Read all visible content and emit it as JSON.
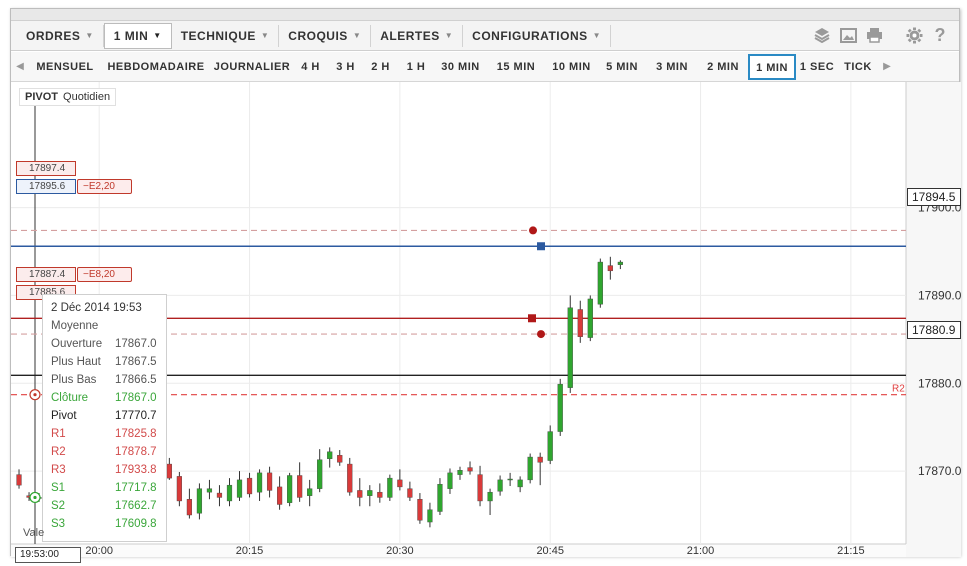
{
  "menu": [
    {
      "label": "ORDRES",
      "caret": true,
      "active": false
    },
    {
      "label": "1 MIN",
      "caret": true,
      "active": true
    },
    {
      "label": "TECHNIQUE",
      "caret": true,
      "active": false
    },
    {
      "label": "CROQUIS",
      "caret": true,
      "active": false
    },
    {
      "label": "ALERTES",
      "caret": true,
      "active": false
    },
    {
      "label": "CONFIGURATIONS",
      "caret": true,
      "active": false
    }
  ],
  "tools": [
    "layers-icon",
    "image-icon",
    "print-icon",
    "gear-icon",
    "help-icon"
  ],
  "timeframes": [
    "MENSUEL",
    "HEBDOMADAIRE",
    "JOURNALIER",
    "4 H",
    "3 H",
    "2 H",
    "1 H",
    "30 MIN",
    "15 MIN",
    "10 MIN",
    "5 MIN",
    "3 MIN",
    "2 MIN",
    "1 MIN",
    "1 SEC",
    "TICK"
  ],
  "active_timeframe": "1 MIN",
  "pivot": {
    "name": "PIVOT",
    "period": "Quotidien"
  },
  "levels": {
    "dash_top": "17897.4",
    "current": "17895.6",
    "current_order": "−E2,20",
    "mid": "17887.4",
    "mid_order": "−E8,20",
    "dash_bottom": "17885.6",
    "last_price": "17894.5",
    "cursor_price": "17880.9",
    "r2_label": "R2"
  },
  "infobox": {
    "date": "2 Déc 2014 19:53",
    "type": "Moyenne",
    "rows": [
      {
        "k": "Ouverture",
        "v": "17867.0",
        "color": "grey"
      },
      {
        "k": "Plus Haut",
        "v": "17867.5",
        "color": "grey"
      },
      {
        "k": "Plus Bas",
        "v": "17866.5",
        "color": "grey"
      },
      {
        "k": "Clôture",
        "v": "17867.0",
        "color": "green"
      },
      {
        "k": "Pivot",
        "v": "17770.7",
        "color": "dark"
      },
      {
        "k": "R1",
        "v": "17825.8",
        "color": "red"
      },
      {
        "k": "R2",
        "v": "17878.7",
        "color": "red"
      },
      {
        "k": "R3",
        "v": "17933.8",
        "color": "red"
      },
      {
        "k": "S1",
        "v": "17717.8",
        "color": "green"
      },
      {
        "k": "S2",
        "v": "17662.7",
        "color": "green"
      },
      {
        "k": "S3",
        "v": "17609.8",
        "color": "green"
      }
    ]
  },
  "cursor_time": "19:53:00",
  "val_label": "Vale",
  "chart_data": {
    "type": "candlestick",
    "y_ticks": [
      "17900.0",
      "17890.0",
      "17880.0",
      "17870.0"
    ],
    "y_ticks_values": [
      17900,
      17890,
      17880,
      17870
    ],
    "ylim": [
      17861.7,
      17914.3
    ],
    "x_ticks": [
      "20:00",
      "20:15",
      "20:30",
      "20:45",
      "21:00",
      "21:15"
    ],
    "x_ticks_minutes": [
      0,
      15,
      30,
      45,
      60,
      75
    ],
    "xlim_minutes": [
      -8.8,
      80.5
    ],
    "colors": {
      "up": "#2fa62f",
      "down": "#d93a3a",
      "level": "#c0392b",
      "current": "#2c5aa0"
    },
    "candles": [
      {
        "t": -8,
        "o": 17869.6,
        "h": 17870.2,
        "l": 17868.0,
        "c": 17868.4
      },
      {
        "t": -7,
        "o": 17867.2,
        "h": 17867.6,
        "l": 17866.6,
        "c": 17867.0
      },
      {
        "t": -6,
        "o": 17867.0,
        "h": 17867.5,
        "l": 17866.5,
        "c": 17867.0
      },
      {
        "t": -5,
        "o": 17866.5,
        "h": 17867.5,
        "l": 17866.0,
        "c": 17867.2
      },
      {
        "t": -4,
        "o": 17867.3,
        "h": 17868.0,
        "l": 17865.0,
        "c": 17865.5
      },
      {
        "t": -3,
        "o": 17865.7,
        "h": 17867.0,
        "l": 17864.0,
        "c": 17866.5
      },
      {
        "t": -2,
        "o": 17866.5,
        "h": 17867.4,
        "l": 17865.6,
        "c": 17866.0
      },
      {
        "t": -1,
        "o": 17866.1,
        "h": 17867.5,
        "l": 17865.0,
        "c": 17867.0
      },
      {
        "t": 0,
        "o": 17867.2,
        "h": 17868.5,
        "l": 17866.3,
        "c": 17866.8
      },
      {
        "t": 1,
        "o": 17866.5,
        "h": 17867.3,
        "l": 17864.8,
        "c": 17865.2
      },
      {
        "t": 2,
        "o": 17865.4,
        "h": 17867.0,
        "l": 17864.6,
        "c": 17866.8
      },
      {
        "t": 3,
        "o": 17866.8,
        "h": 17869.0,
        "l": 17866.0,
        "c": 17868.5
      },
      {
        "t": 4,
        "o": 17868.5,
        "h": 17870.5,
        "l": 17868.0,
        "c": 17870.1
      },
      {
        "t": 5,
        "o": 17869.2,
        "h": 17870.5,
        "l": 17867.5,
        "c": 17867.8
      },
      {
        "t": 6,
        "o": 17868.0,
        "h": 17869.8,
        "l": 17867.0,
        "c": 17869.3
      },
      {
        "t": 7,
        "o": 17870.8,
        "h": 17871.5,
        "l": 17869.0,
        "c": 17869.2
      },
      {
        "t": 8,
        "o": 17869.4,
        "h": 17869.9,
        "l": 17866.0,
        "c": 17866.6
      },
      {
        "t": 9,
        "o": 17866.8,
        "h": 17868.0,
        "l": 17864.6,
        "c": 17865.0
      },
      {
        "t": 10,
        "o": 17865.2,
        "h": 17868.6,
        "l": 17864.5,
        "c": 17868.0
      },
      {
        "t": 11,
        "o": 17867.6,
        "h": 17869.0,
        "l": 17866.8,
        "c": 17868.0
      },
      {
        "t": 12,
        "o": 17867.5,
        "h": 17868.4,
        "l": 17866.0,
        "c": 17867.0
      },
      {
        "t": 13,
        "o": 17866.6,
        "h": 17869.2,
        "l": 17866.0,
        "c": 17868.4
      },
      {
        "t": 14,
        "o": 17867.0,
        "h": 17870.0,
        "l": 17866.6,
        "c": 17869.0
      },
      {
        "t": 15,
        "o": 17869.2,
        "h": 17869.8,
        "l": 17867.0,
        "c": 17867.4
      },
      {
        "t": 16,
        "o": 17867.6,
        "h": 17870.2,
        "l": 17866.6,
        "c": 17869.8
      },
      {
        "t": 17,
        "o": 17869.8,
        "h": 17870.5,
        "l": 17867.0,
        "c": 17867.8
      },
      {
        "t": 18,
        "o": 17868.2,
        "h": 17869.4,
        "l": 17865.6,
        "c": 17866.2
      },
      {
        "t": 19,
        "o": 17866.4,
        "h": 17869.8,
        "l": 17866.0,
        "c": 17869.5
      },
      {
        "t": 20,
        "o": 17869.5,
        "h": 17871.0,
        "l": 17866.5,
        "c": 17867.0
      },
      {
        "t": 21,
        "o": 17867.2,
        "h": 17869.0,
        "l": 17866.0,
        "c": 17868.0
      },
      {
        "t": 22,
        "o": 17868.0,
        "h": 17872.5,
        "l": 17867.6,
        "c": 17871.3
      },
      {
        "t": 23,
        "o": 17871.4,
        "h": 17872.7,
        "l": 17870.4,
        "c": 17872.2
      },
      {
        "t": 24,
        "o": 17871.8,
        "h": 17872.4,
        "l": 17870.6,
        "c": 17871.0
      },
      {
        "t": 25,
        "o": 17870.8,
        "h": 17871.5,
        "l": 17867.2,
        "c": 17867.6
      },
      {
        "t": 26,
        "o": 17867.8,
        "h": 17869.2,
        "l": 17866.0,
        "c": 17867.0
      },
      {
        "t": 27,
        "o": 17867.2,
        "h": 17868.4,
        "l": 17866.0,
        "c": 17867.8
      },
      {
        "t": 28,
        "o": 17867.6,
        "h": 17868.6,
        "l": 17866.4,
        "c": 17867.0
      },
      {
        "t": 29,
        "o": 17867.0,
        "h": 17869.6,
        "l": 17866.6,
        "c": 17869.2
      },
      {
        "t": 30,
        "o": 17869.0,
        "h": 17870.2,
        "l": 17867.8,
        "c": 17868.2
      },
      {
        "t": 31,
        "o": 17868.0,
        "h": 17868.8,
        "l": 17866.6,
        "c": 17867.0
      },
      {
        "t": 32,
        "o": 17866.8,
        "h": 17867.5,
        "l": 17864.0,
        "c": 17864.4
      },
      {
        "t": 33,
        "o": 17864.2,
        "h": 17866.4,
        "l": 17863.6,
        "c": 17865.6
      },
      {
        "t": 34,
        "o": 17865.4,
        "h": 17869.2,
        "l": 17865.0,
        "c": 17868.5
      },
      {
        "t": 35,
        "o": 17868.0,
        "h": 17870.3,
        "l": 17867.4,
        "c": 17869.8
      },
      {
        "t": 36,
        "o": 17869.6,
        "h": 17870.5,
        "l": 17869.0,
        "c": 17870.1
      },
      {
        "t": 37,
        "o": 17870.4,
        "h": 17871.1,
        "l": 17869.6,
        "c": 17870.0
      },
      {
        "t": 38,
        "o": 17869.6,
        "h": 17870.6,
        "l": 17866.0,
        "c": 17866.6
      },
      {
        "t": 39,
        "o": 17866.6,
        "h": 17868.0,
        "l": 17865.0,
        "c": 17867.6
      },
      {
        "t": 40,
        "o": 17867.7,
        "h": 17869.5,
        "l": 17867.2,
        "c": 17869.0
      },
      {
        "t": 41,
        "o": 17869.0,
        "h": 17869.8,
        "l": 17868.3,
        "c": 17869.1
      },
      {
        "t": 42,
        "o": 17868.2,
        "h": 17869.4,
        "l": 17867.6,
        "c": 17869.0
      },
      {
        "t": 43,
        "o": 17869.0,
        "h": 17872.0,
        "l": 17868.6,
        "c": 17871.6
      },
      {
        "t": 44,
        "o": 17871.6,
        "h": 17872.1,
        "l": 17868.4,
        "c": 17871.0
      },
      {
        "t": 45,
        "o": 17871.2,
        "h": 17875.2,
        "l": 17870.8,
        "c": 17874.5
      },
      {
        "t": 46,
        "o": 17874.5,
        "h": 17880.5,
        "l": 17874.0,
        "c": 17879.9
      },
      {
        "t": 47,
        "o": 17879.5,
        "h": 17890.0,
        "l": 17878.9,
        "c": 17888.6
      },
      {
        "t": 48,
        "o": 17888.4,
        "h": 17889.4,
        "l": 17884.6,
        "c": 17885.3
      },
      {
        "t": 49,
        "o": 17885.2,
        "h": 17890.0,
        "l": 17884.8,
        "c": 17889.6
      },
      {
        "t": 50,
        "o": 17889.0,
        "h": 17894.2,
        "l": 17888.6,
        "c": 17893.8
      },
      {
        "t": 51,
        "o": 17893.4,
        "h": 17894.4,
        "l": 17891.8,
        "c": 17892.8
      },
      {
        "t": 52,
        "o": 17893.5,
        "h": 17894.0,
        "l": 17893.0,
        "c": 17893.8
      }
    ],
    "hlines": [
      {
        "value": 17897.4,
        "style": "dashed",
        "color": "#d4a0a0"
      },
      {
        "value": 17895.6,
        "style": "solid",
        "color": "#2c5aa0"
      },
      {
        "value": 17887.4,
        "style": "solid",
        "color": "#b02020"
      },
      {
        "value": 17885.6,
        "style": "dashed",
        "color": "#d4a0a0"
      },
      {
        "value": 17880.9,
        "style": "solid",
        "color": "#222222"
      },
      {
        "value": 17878.7,
        "style": "dashed",
        "color": "#e04040"
      }
    ]
  }
}
